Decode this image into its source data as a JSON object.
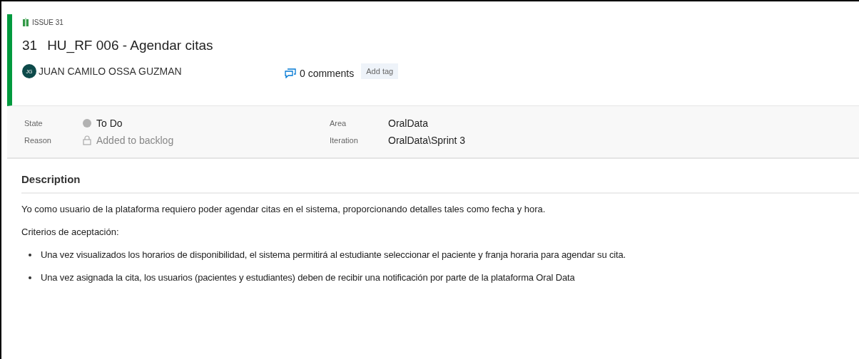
{
  "work_item": {
    "type_label": "ISSUE 31",
    "id": "31",
    "title": "HU_RF 006 - Agendar citas",
    "avatar_initials": "JG",
    "assignee": "JUAN CAMILO OSSA GUZMAN",
    "comments": "0 comments",
    "add_tag": "Add tag"
  },
  "fields": [
    {
      "label": "State",
      "value": "To Do",
      "kind": "state"
    },
    {
      "label": "Area",
      "value": "OralData",
      "kind": "plain"
    },
    {
      "label": "Reason",
      "value": "Added to backlog",
      "kind": "locked"
    },
    {
      "label": "Iteration",
      "value": "OralData\\Sprint 3",
      "kind": "plain"
    }
  ],
  "description": {
    "heading": "Description",
    "paragraphs": [
      "Yo como usuario de la plataforma requiero poder agendar citas en el sistema, proporcionando detalles tales como fecha y hora.",
      "Criterios de aceptación:"
    ],
    "bullets": [
      "Una vez visualizados los horarios de disponibilidad, el sistema permitirá al estudiante seleccionar el paciente y franja horaria para agendar su cita.",
      "Una vez asignada la cita, los usuarios (pacientes y estudiantes) deben de recibir una notificación por parte de la plataforma Oral Data"
    ]
  }
}
